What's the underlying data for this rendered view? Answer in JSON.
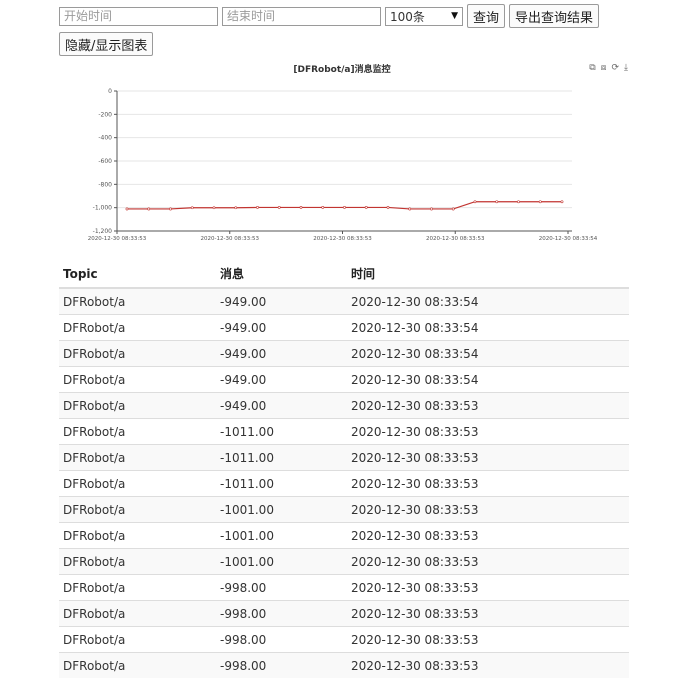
{
  "toolbar": {
    "start_placeholder": "开始时间",
    "end_placeholder": "结束时间",
    "limit_value": "100条",
    "query_label": "查询",
    "export_label": "导出查询结果",
    "toggle_chart_label": "隐藏/显示图表"
  },
  "chart": {
    "title": "[DFRobot/a]消息监控",
    "tools": [
      "zoom-icon",
      "zoom-reset-icon",
      "restore-icon",
      "download-icon"
    ]
  },
  "chart_data": {
    "type": "line",
    "title": "[DFRobot/a]消息监控",
    "xlabel": "",
    "ylabel": "",
    "ylim": [
      -1200,
      0
    ],
    "yticks": [
      "0",
      "-200",
      "-400",
      "-600",
      "-800",
      "-1,000",
      "-1,200"
    ],
    "x_ticklabels": [
      "2020-12-30 08:33:53",
      "2020-12-30 08:33:53",
      "2020-12-30 08:33:53",
      "2020-12-30 08:33:53",
      "2020-12-30 08:33:54"
    ],
    "grid": true,
    "color": "#c23531",
    "values": [
      -1011,
      -1011,
      -1011,
      -1001,
      -1001,
      -1001,
      -998,
      -998,
      -998,
      -998,
      -998,
      -998,
      -998,
      -1011,
      -1011,
      -1011,
      -949,
      -949,
      -949,
      -949,
      -949
    ]
  },
  "table": {
    "headers": [
      "Topic",
      "消息",
      "时间"
    ],
    "rows": [
      [
        "DFRobot/a",
        "-949.00",
        "2020-12-30 08:33:54"
      ],
      [
        "DFRobot/a",
        "-949.00",
        "2020-12-30 08:33:54"
      ],
      [
        "DFRobot/a",
        "-949.00",
        "2020-12-30 08:33:54"
      ],
      [
        "DFRobot/a",
        "-949.00",
        "2020-12-30 08:33:54"
      ],
      [
        "DFRobot/a",
        "-949.00",
        "2020-12-30 08:33:53"
      ],
      [
        "DFRobot/a",
        "-1011.00",
        "2020-12-30 08:33:53"
      ],
      [
        "DFRobot/a",
        "-1011.00",
        "2020-12-30 08:33:53"
      ],
      [
        "DFRobot/a",
        "-1011.00",
        "2020-12-30 08:33:53"
      ],
      [
        "DFRobot/a",
        "-1001.00",
        "2020-12-30 08:33:53"
      ],
      [
        "DFRobot/a",
        "-1001.00",
        "2020-12-30 08:33:53"
      ],
      [
        "DFRobot/a",
        "-1001.00",
        "2020-12-30 08:33:53"
      ],
      [
        "DFRobot/a",
        "-998.00",
        "2020-12-30 08:33:53"
      ],
      [
        "DFRobot/a",
        "-998.00",
        "2020-12-30 08:33:53"
      ],
      [
        "DFRobot/a",
        "-998.00",
        "2020-12-30 08:33:53"
      ],
      [
        "DFRobot/a",
        "-998.00",
        "2020-12-30 08:33:53"
      ]
    ]
  }
}
